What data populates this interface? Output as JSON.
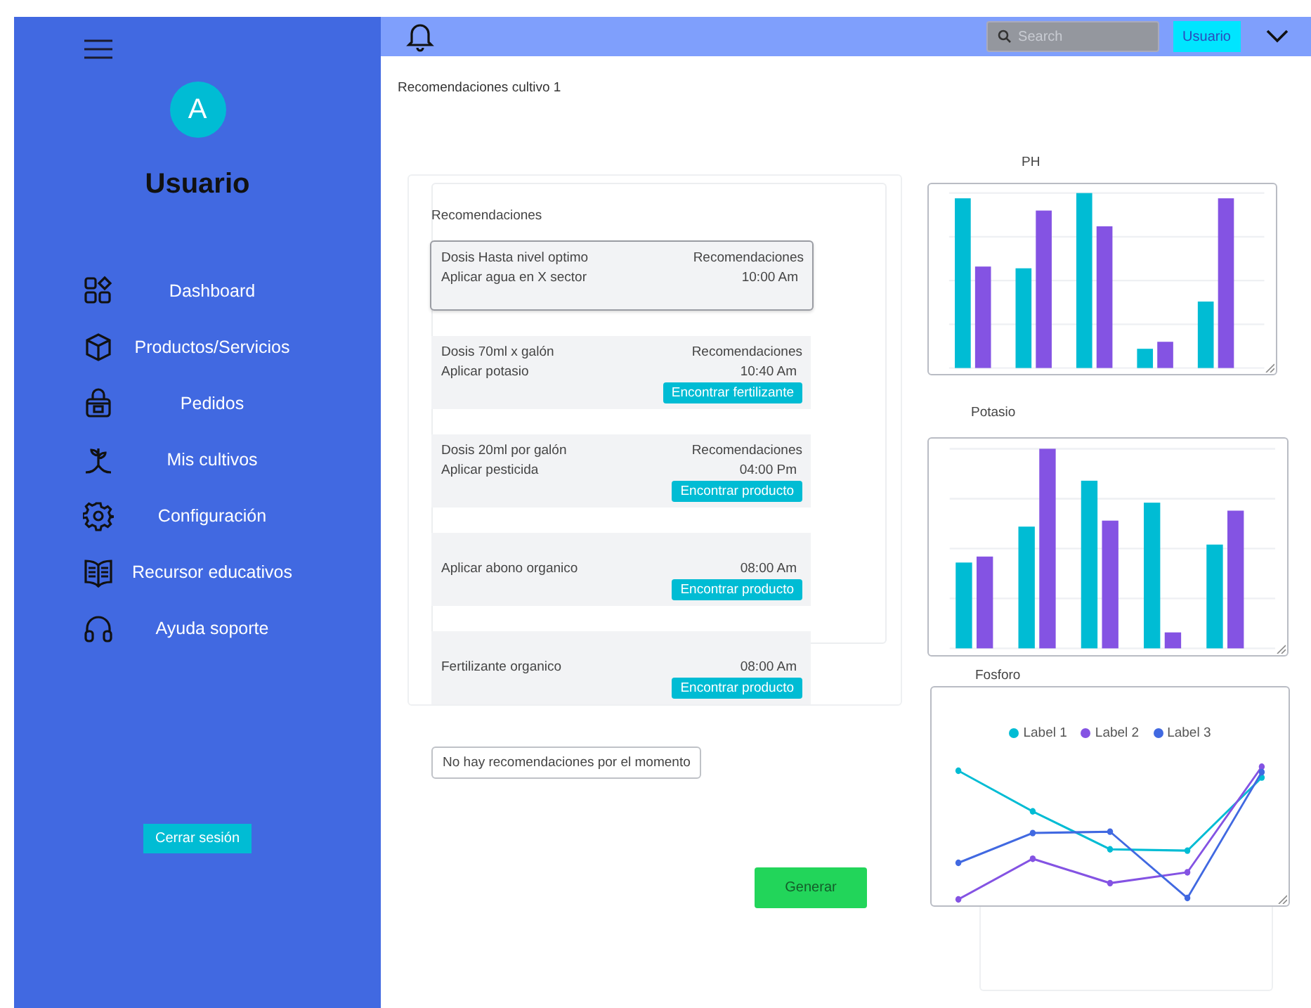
{
  "sidebar": {
    "avatar_letter": "A",
    "user_name": "Usuario",
    "items": [
      {
        "label": "Dashboard"
      },
      {
        "label": "Productos/Servicios"
      },
      {
        "label": "Pedidos"
      },
      {
        "label": "Mis cultivos"
      },
      {
        "label": "Configuración"
      },
      {
        "label": "Recursor educativos"
      },
      {
        "label": "Ayuda soporte"
      }
    ],
    "logout_button": "Cerrar sesión"
  },
  "top_bar": {
    "search": {
      "placeholder": "Search"
    },
    "user_button": "Usuario"
  },
  "breadcrumb": "Recomendaciones cultivo 1",
  "recommendations": {
    "title": "Recomendaciones",
    "items": [
      {
        "dose": "Dosis  Hasta nivel optimo",
        "label": "Recomendaciones",
        "action": "Aplicar agua en X sector",
        "time": "10:00 Am",
        "selected": true
      },
      {
        "dose": "Dosis  70ml x galón",
        "label": "Recomendaciones",
        "action": "Aplicar potasio",
        "time": "10:40 Am",
        "button": "Encontrar fertilizante",
        "selected": false
      },
      {
        "dose": "Dosis  20ml por galón",
        "label": "Recomendaciones",
        "action": "Aplicar pesticida",
        "time": "04:00 Pm",
        "button": "Encontrar producto",
        "selected": false
      },
      {
        "action": "Aplicar abono organico",
        "time": "08:00 Am",
        "button": "Encontrar producto",
        "selected": false
      },
      {
        "action": "Fertilizante organico",
        "time": "08:00 Am",
        "button": "Encontrar producto",
        "selected": false
      }
    ]
  },
  "empty_message": "No hay recomendaciones por el momento",
  "generate_button": "Generar",
  "charts": [
    {
      "title": "PH",
      "kind": "bar"
    },
    {
      "title": "Potasio",
      "kind": "bar"
    },
    {
      "title": "Fosforo",
      "kind": "line",
      "legend": [
        {
          "label": "Label 1",
          "color": "#00bcd4"
        },
        {
          "label": "Label 2",
          "color": "#8453e3"
        },
        {
          "label": "Label 3",
          "color": "#4169e1"
        }
      ]
    }
  ]
}
